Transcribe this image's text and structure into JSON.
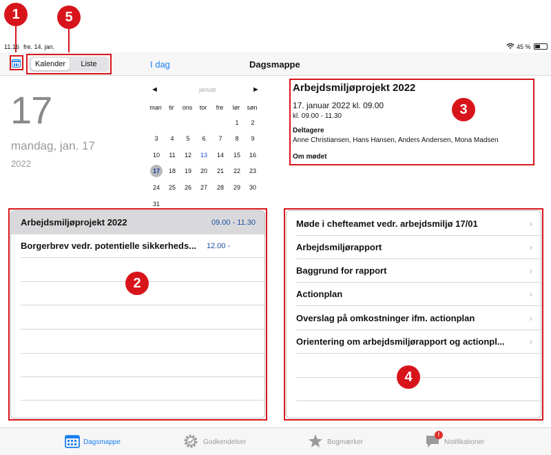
{
  "callouts": [
    "1",
    "5",
    "3",
    "2",
    "4"
  ],
  "statusbar": {
    "time": "11.16",
    "date": "fre. 14. jan.",
    "battery": "45 %",
    "battery_level": 0.45
  },
  "navbar": {
    "segments": [
      "Kalender",
      "Liste"
    ],
    "today_link": "I dag",
    "title": "Dagsmappe"
  },
  "date_display": {
    "day": "17",
    "weekday": "mandag, jan. 17",
    "year": "2022"
  },
  "mini_calendar": {
    "month": "januar",
    "prev": "◄",
    "next": "►",
    "headers": [
      "man",
      "tir",
      "ons",
      "tor",
      "fre",
      "lør",
      "søn"
    ],
    "weeks": [
      [
        "",
        "",
        "",
        "",
        "",
        "1",
        "2"
      ],
      [
        "3",
        "4",
        "5",
        "6",
        "7",
        "8",
        "9"
      ],
      [
        "10",
        "11",
        "12",
        "13",
        "14",
        "15",
        "16"
      ],
      [
        "17",
        "18",
        "19",
        "20",
        "21",
        "22",
        "23"
      ],
      [
        "24",
        "25",
        "26",
        "27",
        "28",
        "29",
        "30"
      ],
      [
        "31",
        "",
        "",
        "",
        "",
        "",
        ""
      ]
    ],
    "highlight_day": "13",
    "selected_day": "17"
  },
  "event": {
    "title": "Arbejdsmiljøprojekt 2022",
    "when": "17. januar 2022 kl. 09.00",
    "time": "kl. 09.00 - 11.30",
    "participants_label": "Deltagere",
    "participants": "Anne Christiansen, Hans Hansen, Anders Andersen, Mona Madsen",
    "about_label": "Om mødet"
  },
  "appointments": [
    {
      "title": "Arbejdsmiljøprojekt 2022",
      "time": "09.00 - 11.30"
    },
    {
      "title": "Borgerbrev vedr. potentielle sikkerheds...",
      "time": "12.00 -"
    }
  ],
  "documents": [
    {
      "title": "Møde i chefteamet vedr. arbejdsmiljø 17/01"
    },
    {
      "title": "Arbejdsmiljørapport"
    },
    {
      "title": "Baggrund for rapport"
    },
    {
      "title": "Actionplan"
    },
    {
      "title": "Overslag på omkostninger ifm. actionplan"
    },
    {
      "title": "Orientering om arbejdsmiljørapport og actionpl..."
    }
  ],
  "tabbar": {
    "tabs": [
      "Dagsmappe",
      "Godkendelser",
      "Bogmærker",
      "Notifikationer"
    ],
    "badge": "!"
  },
  "colors": {
    "accent": "#1a7ff0",
    "callout": "#d8141b",
    "inactive_tab": "#9a9a9a"
  }
}
